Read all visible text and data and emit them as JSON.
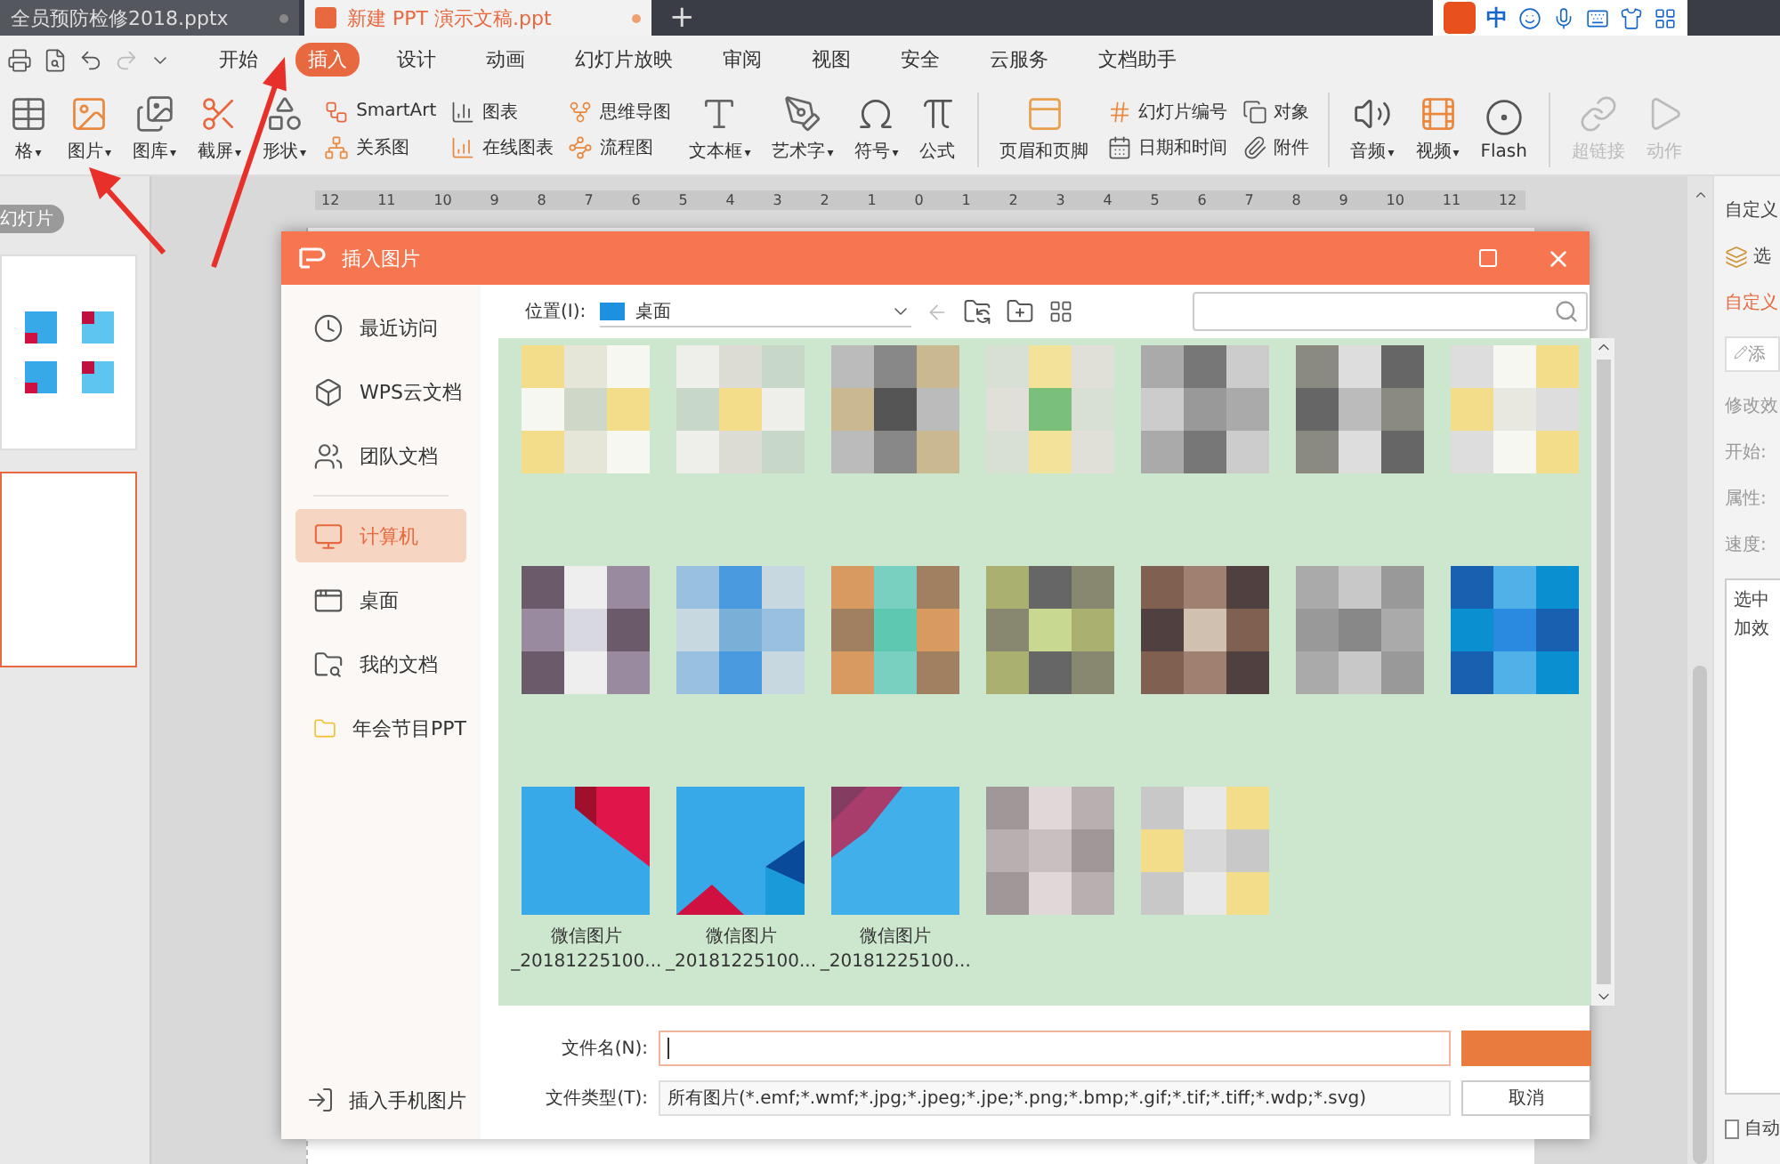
{
  "tabs": [
    {
      "label": "全员预防检修2018.pptx",
      "selected": false
    },
    {
      "label": "新建 PPT 演示文稿.ppt",
      "selected": true
    }
  ],
  "new_tab": "+",
  "ime": {
    "label": "中"
  },
  "menu": [
    {
      "label": "开始",
      "selected": false
    },
    {
      "label": "插入",
      "selected": true
    },
    {
      "label": "设计",
      "selected": false
    },
    {
      "label": "动画",
      "selected": false
    },
    {
      "label": "幻灯片放映",
      "selected": false
    },
    {
      "label": "审阅",
      "selected": false
    },
    {
      "label": "视图",
      "selected": false
    },
    {
      "label": "安全",
      "selected": false
    },
    {
      "label": "云服务",
      "selected": false
    },
    {
      "label": "文档助手",
      "selected": false
    }
  ],
  "ribbon": [
    {
      "kind": "large",
      "label": "格",
      "caret": "▾",
      "disabled": false
    },
    {
      "kind": "large",
      "label": "图片",
      "caret": "▾",
      "disabled": false
    },
    {
      "kind": "large",
      "label": "图库",
      "caret": "▾",
      "disabled": false
    },
    {
      "kind": "large",
      "label": "截屏",
      "caret": "▾",
      "disabled": false
    },
    {
      "kind": "large",
      "label": "形状",
      "caret": "▾",
      "disabled": false
    },
    {
      "kind": "stack",
      "items": [
        {
          "label": "SmartArt",
          "disabled": false
        },
        {
          "label": "关系图",
          "disabled": false
        }
      ]
    },
    {
      "kind": "stack",
      "items": [
        {
          "label": "图表",
          "disabled": false
        },
        {
          "label": "在线图表",
          "disabled": false
        }
      ]
    },
    {
      "kind": "stack",
      "items": [
        {
          "label": "思维导图",
          "disabled": false
        },
        {
          "label": "流程图",
          "disabled": false
        }
      ]
    },
    {
      "kind": "large",
      "label": "文本框",
      "caret": "▾",
      "disabled": false
    },
    {
      "kind": "large",
      "label": "艺术字",
      "caret": "▾",
      "disabled": false
    },
    {
      "kind": "large",
      "label": "符号",
      "caret": "▾",
      "disabled": false
    },
    {
      "kind": "large",
      "label": "公式",
      "disabled": false
    },
    {
      "kind": "separator"
    },
    {
      "kind": "large",
      "label": "页眉和页脚",
      "disabled": false
    },
    {
      "kind": "stack",
      "items": [
        {
          "label": "幻灯片编号",
          "disabled": false
        },
        {
          "label": "日期和时间",
          "disabled": false
        }
      ]
    },
    {
      "kind": "stack",
      "items": [
        {
          "label": "对象",
          "disabled": false
        },
        {
          "label": "附件",
          "disabled": false
        }
      ]
    },
    {
      "kind": "separator"
    },
    {
      "kind": "large",
      "label": "音频",
      "caret": "▾",
      "disabled": false
    },
    {
      "kind": "large",
      "label": "视频",
      "caret": "▾",
      "disabled": false
    },
    {
      "kind": "large",
      "label": "Flash",
      "disabled": false
    },
    {
      "kind": "separator"
    },
    {
      "kind": "large",
      "label": "超链接",
      "disabled": true
    },
    {
      "kind": "large",
      "label": "动作",
      "disabled": true
    }
  ],
  "slides_panel": {
    "label": "幻灯片",
    "slides": [
      {
        "kind": "pictures",
        "selected": false
      },
      {
        "kind": "blank",
        "selected": true
      }
    ]
  },
  "ruler": [
    "12",
    "11",
    "10",
    "9",
    "8",
    "7",
    "6",
    "5",
    "4",
    "3",
    "2",
    "1",
    "0",
    "1",
    "2",
    "3",
    "4",
    "5",
    "6",
    "7",
    "8",
    "9",
    "10",
    "11",
    "12"
  ],
  "task_pane": {
    "title": "自定义",
    "select_label": "选",
    "section": "自定义",
    "add_button": "添",
    "modify_label": "修改效",
    "fields": [
      "开始:",
      "属性:",
      "速度:"
    ],
    "list_text": [
      "选中",
      "加效"
    ],
    "auto_label": "自动",
    "auto_checked": false
  },
  "dialog": {
    "title": "插入图片",
    "place_groups": [
      [
        {
          "label": "最近访问",
          "selected": false
        },
        {
          "label": "WPS云文档",
          "selected": false
        },
        {
          "label": "团队文档",
          "selected": false
        }
      ],
      [
        {
          "label": "计算机",
          "selected": true
        },
        {
          "label": "桌面",
          "selected": false
        },
        {
          "label": "我的文档",
          "selected": false
        },
        {
          "label": "年会节目PPT",
          "selected": false
        }
      ]
    ],
    "phone_link": "插入手机图片",
    "location_label": "位置(I):",
    "location": "桌面",
    "files": [
      {
        "kind": "picture"
      },
      {
        "kind": "picture"
      },
      {
        "kind": "picture"
      },
      {
        "kind": "picture"
      },
      {
        "kind": "picture"
      },
      {
        "kind": "picture"
      },
      {
        "kind": "picture"
      },
      {
        "kind": "picture"
      },
      {
        "kind": "picture"
      },
      {
        "kind": "picture"
      },
      {
        "kind": "picture"
      },
      {
        "kind": "picture"
      },
      {
        "kind": "picture"
      },
      {
        "kind": "picture"
      },
      {
        "kind": "picture",
        "caption": [
          "微信图片",
          "_20181225100..."
        ]
      },
      {
        "kind": "picture",
        "caption": [
          "微信图片",
          "_20181225100..."
        ]
      },
      {
        "kind": "picture",
        "caption": [
          "微信图片",
          "_20181225100..."
        ]
      },
      {
        "kind": "picture"
      },
      {
        "kind": "picture"
      }
    ],
    "file_name_label": "文件名(N):",
    "file_type_label": "文件类型(T):",
    "file_type": "所有图片(*.emf;*.wmf;*.jpg;*.jpeg;*.jpe;*.png;*.bmp;*.gif;*.tif;*.tiff;*.wdp;*.svg)",
    "cancel": "取消"
  }
}
